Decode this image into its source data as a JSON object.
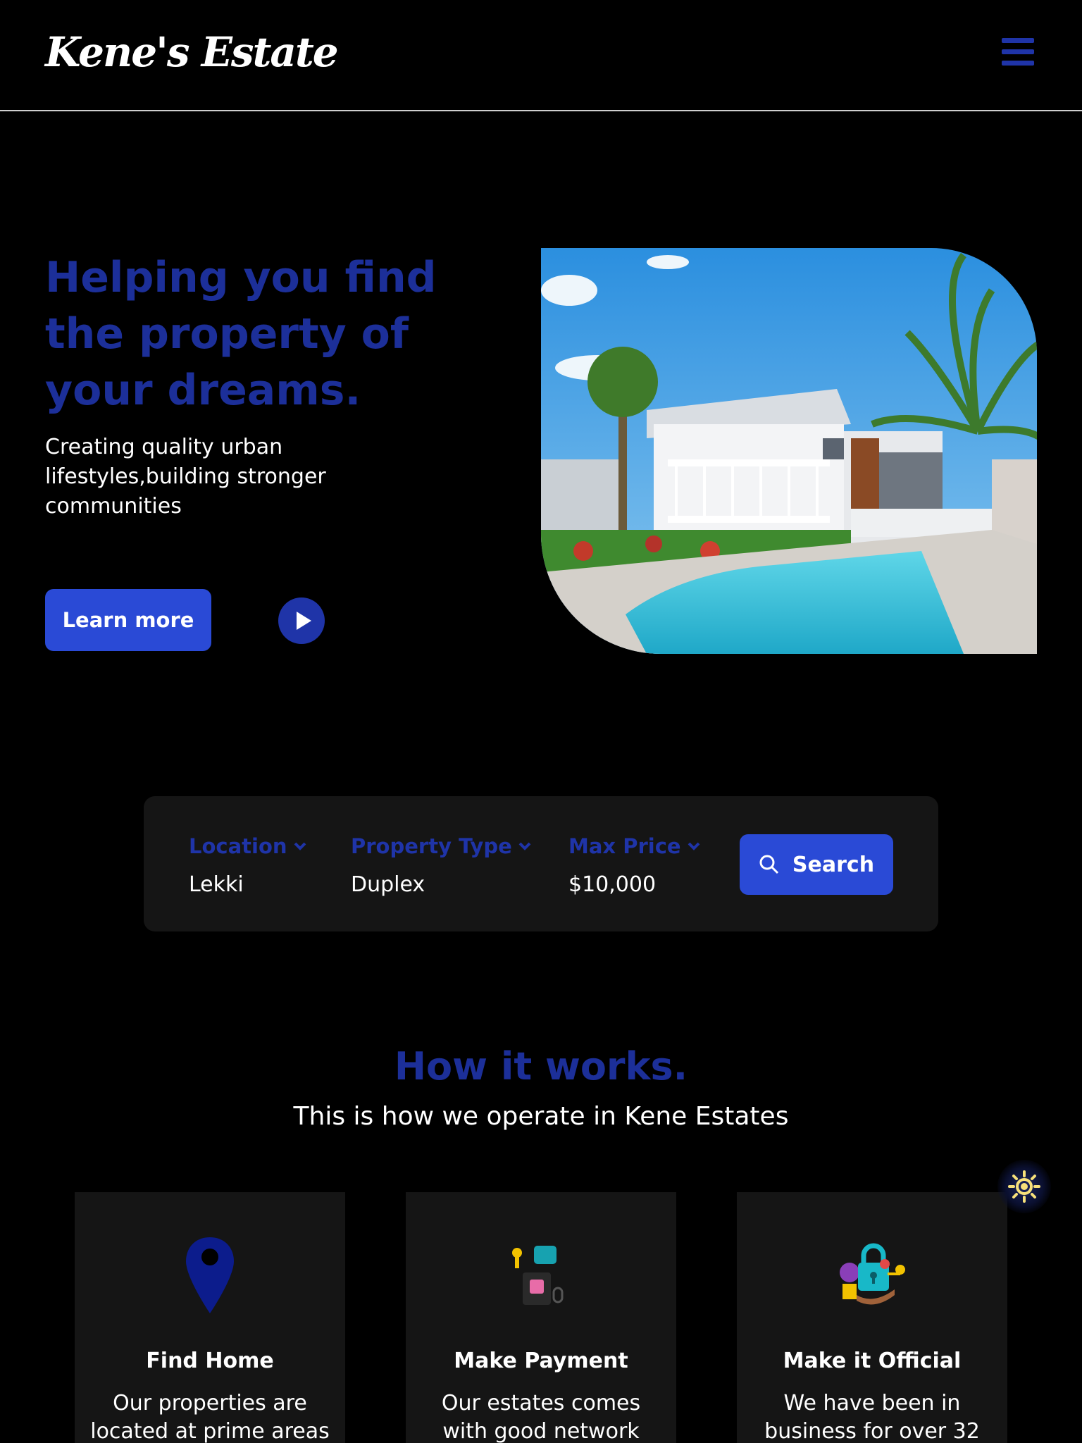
{
  "header": {
    "logo": "Kene's Estate",
    "menu_icon": "hamburger-icon"
  },
  "hero": {
    "title": "Helping you find the property of your dreams.",
    "subtitle": "Creating quality urban lifestyles,building stronger communities",
    "learn_more_label": "Learn more",
    "play_icon": "play-icon"
  },
  "search": {
    "fields": [
      {
        "label": "Location",
        "value": "Lekki",
        "icon": "chevron-down-icon"
      },
      {
        "label": "Property Type",
        "value": "Duplex",
        "icon": "chevron-down-icon"
      },
      {
        "label": "Max Price",
        "value": "$10,000",
        "icon": "chevron-down-icon"
      }
    ],
    "button_label": "Search",
    "button_icon": "search-icon"
  },
  "how_it_works": {
    "title": "How it works.",
    "subtitle": "This is how we operate in Kene Estates",
    "cards": [
      {
        "title": "Find Home",
        "text": "Our properties are located at prime areas",
        "icon": "location-pin-icon"
      },
      {
        "title": "Make Payment",
        "text": "Our estates comes with good network",
        "icon": "payment-icon"
      },
      {
        "title": "Make it Official",
        "text": "We have been in business for over 32",
        "icon": "security-lock-icon"
      }
    ]
  },
  "theme_toggle_icon": "sun-icon",
  "colors": {
    "accent": "#1c2f99",
    "button": "#2a4ad6",
    "card": "#151515",
    "background": "#000000"
  }
}
